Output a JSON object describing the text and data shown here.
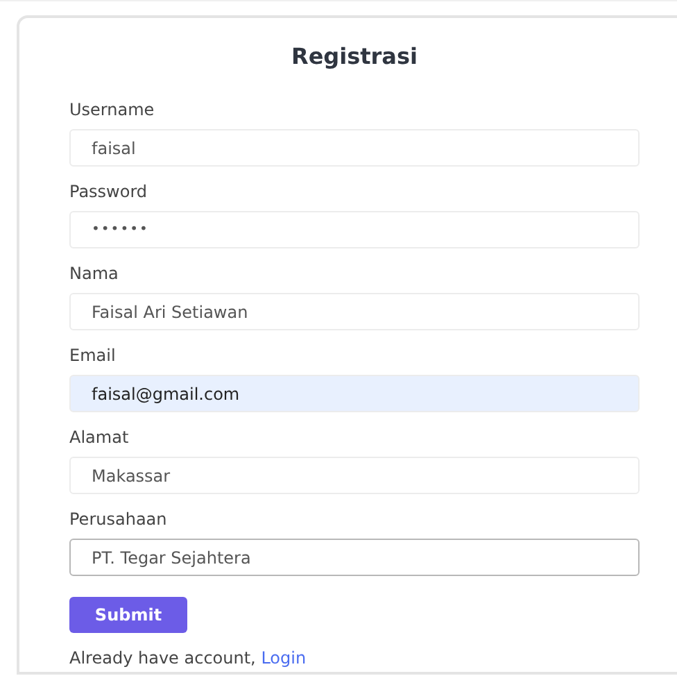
{
  "title": "Registrasi",
  "fields": [
    {
      "label": "Username",
      "value": "faisal",
      "kind": "text",
      "autofilled": false,
      "focused": false
    },
    {
      "label": "Password",
      "value": "••••••",
      "kind": "password",
      "autofilled": false,
      "focused": false
    },
    {
      "label": "Nama",
      "value": "Faisal Ari Setiawan",
      "kind": "text",
      "autofilled": false,
      "focused": false
    },
    {
      "label": "Email",
      "value": "faisal@gmail.com",
      "kind": "text",
      "autofilled": true,
      "focused": false
    },
    {
      "label": "Alamat",
      "value": "Makassar",
      "kind": "text",
      "autofilled": false,
      "focused": false
    },
    {
      "label": "Perusahaan",
      "value": "PT. Tegar Sejahtera",
      "kind": "text",
      "autofilled": false,
      "focused": true
    }
  ],
  "submit": "Submit",
  "footer": {
    "text": "Already have account,",
    "link": "Login"
  }
}
